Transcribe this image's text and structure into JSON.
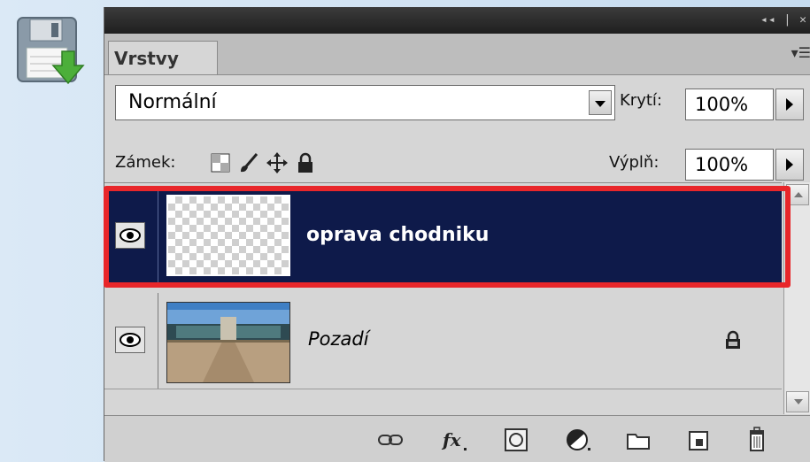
{
  "panel": {
    "tab_label": "Vrstvy",
    "window_controls": "◂◂ | ✕",
    "blend_mode": "Normální",
    "opacity_label": "Krytí:",
    "opacity_value": "100%",
    "lock_label": "Zámek:",
    "fill_label": "Výplň:",
    "fill_value": "100%"
  },
  "layers": [
    {
      "name": "oprava chodniku",
      "visible": true,
      "selected": true,
      "thumbnail": "transparent"
    },
    {
      "name": "Pozadí",
      "visible": true,
      "selected": false,
      "locked": true,
      "thumbnail": "photo"
    }
  ],
  "bottom_toolbar": {
    "icons": [
      "link-icon",
      "fx-icon",
      "mask-icon",
      "adjustment-icon",
      "folder-icon",
      "new-layer-icon",
      "trash-icon"
    ]
  },
  "colors": {
    "selected_row": "#0e1a4a",
    "highlight_box": "#e8262a",
    "panel_bg": "#d6d6d6"
  }
}
